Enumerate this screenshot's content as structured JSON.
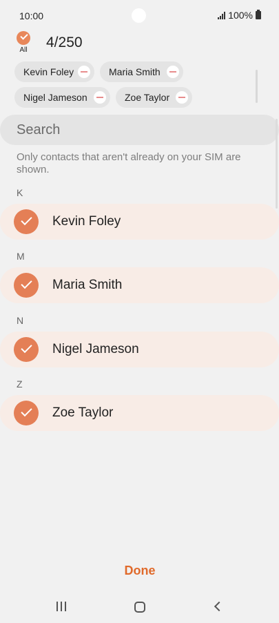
{
  "status_bar": {
    "time": "10:00",
    "battery": "100%"
  },
  "header": {
    "select_all_label": "All",
    "count": "4/250"
  },
  "chips": [
    {
      "label": "Kevin Foley"
    },
    {
      "label": "Maria Smith"
    },
    {
      "label": "Nigel Jameson"
    },
    {
      "label": "Zoe Taylor"
    }
  ],
  "search": {
    "placeholder": "Search"
  },
  "hint": "Only contacts that aren't already on your SIM are shown.",
  "sections": [
    {
      "letter": "K",
      "contact": "Kevin Foley",
      "checked": true
    },
    {
      "letter": "M",
      "contact": "Maria Smith",
      "checked": true
    },
    {
      "letter": "N",
      "contact": "Nigel Jameson",
      "checked": true
    },
    {
      "letter": "Z",
      "contact": "Zoe Taylor",
      "checked": true
    }
  ],
  "footer": {
    "done_label": "Done"
  },
  "colors": {
    "accent": "#e47f56",
    "done": "#e06a2b",
    "row_bg": "#f8ece6",
    "remove_minus": "#e88d8d"
  },
  "icons": {
    "signal": "signal-icon",
    "battery": "battery-icon",
    "check": "check-icon",
    "remove": "minus-circle-icon",
    "recent_apps": "recent-apps-icon",
    "home": "home-icon",
    "back": "back-icon"
  }
}
